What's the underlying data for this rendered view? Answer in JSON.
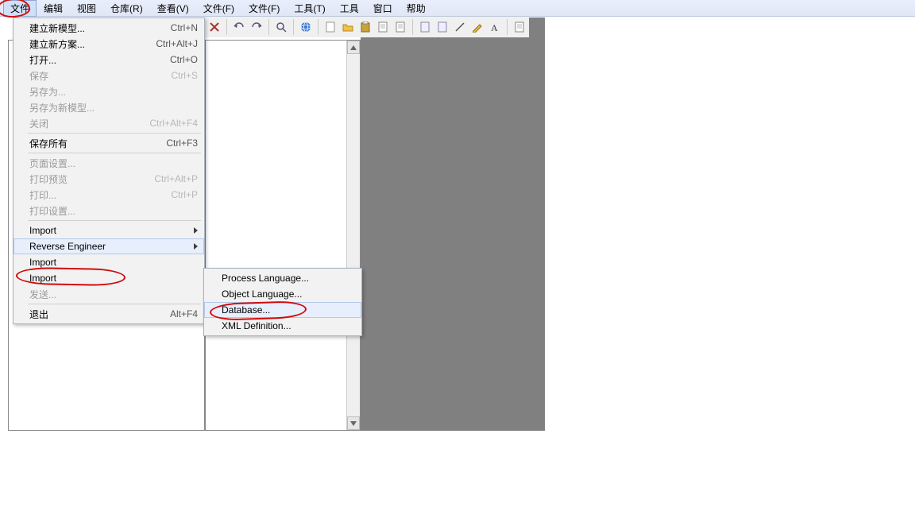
{
  "menubar": {
    "items": [
      "文件",
      "编辑",
      "视图",
      "仓库(R)",
      "查看(V)",
      "文件(F)",
      "文件(F)",
      "工具(T)",
      "工具",
      "窗口",
      "帮助"
    ]
  },
  "dropdown": {
    "items": [
      {
        "label": "建立新模型...",
        "shortcut": "Ctrl+N",
        "enabled": true
      },
      {
        "label": "建立新方案...",
        "shortcut": "Ctrl+Alt+J",
        "enabled": true
      },
      {
        "label": "打开...",
        "shortcut": "Ctrl+O",
        "enabled": true
      },
      {
        "label": "保存",
        "shortcut": "Ctrl+S",
        "enabled": false
      },
      {
        "label": "另存为...",
        "shortcut": "",
        "enabled": false
      },
      {
        "label": "另存为新模型...",
        "shortcut": "",
        "enabled": false
      },
      {
        "label": "关闭",
        "shortcut": "Ctrl+Alt+F4",
        "enabled": false
      },
      {
        "sep": true
      },
      {
        "label": "保存所有",
        "shortcut": "Ctrl+F3",
        "enabled": true
      },
      {
        "sep": true
      },
      {
        "label": "页面设置...",
        "shortcut": "",
        "enabled": false
      },
      {
        "label": "打印预览",
        "shortcut": "Ctrl+Alt+P",
        "enabled": false
      },
      {
        "label": "打印...",
        "shortcut": "Ctrl+P",
        "enabled": false
      },
      {
        "label": "打印设置...",
        "shortcut": "",
        "enabled": false
      },
      {
        "sep": true
      },
      {
        "label": "Import",
        "shortcut": "",
        "enabled": true,
        "submenu": true
      },
      {
        "label": "Reverse Engineer",
        "shortcut": "",
        "enabled": true,
        "submenu": true,
        "hover": true
      },
      {
        "label": "Import",
        "shortcut": "",
        "enabled": true
      },
      {
        "label": "Import",
        "shortcut": "",
        "enabled": true
      },
      {
        "label": "发送...",
        "shortcut": "",
        "enabled": false
      },
      {
        "sep": true
      },
      {
        "label": "退出",
        "shortcut": "Alt+F4",
        "enabled": true
      }
    ]
  },
  "submenu": {
    "items": [
      {
        "label": "Process Language..."
      },
      {
        "label": "Object Language..."
      },
      {
        "label": "Database...",
        "hover": true
      },
      {
        "label": "XML Definition..."
      }
    ]
  },
  "toolbar_icons": [
    "close",
    "sep",
    "undo",
    "redo",
    "sep",
    "find",
    "sep",
    "globe",
    "sep",
    "new",
    "open",
    "paste",
    "page",
    "page",
    "sep",
    "doc",
    "doc",
    "line",
    "pen",
    "text",
    "sep",
    "page"
  ]
}
